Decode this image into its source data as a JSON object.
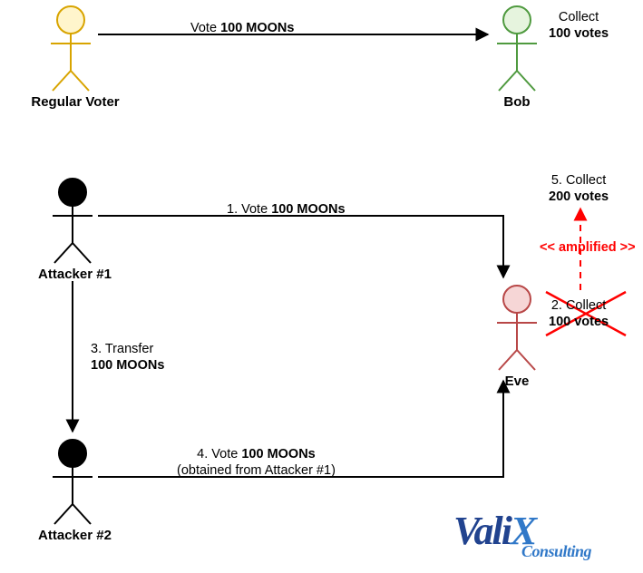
{
  "figures": {
    "regular_voter": {
      "label": "Regular Voter"
    },
    "bob": {
      "label": "Bob"
    },
    "attacker1": {
      "label": "Attacker #1"
    },
    "attacker2": {
      "label": "Attacker #2"
    },
    "eve": {
      "label": "Eve"
    }
  },
  "edges": {
    "vote_regular": {
      "pre": "Vote ",
      "bold": "100 MOONs",
      "post": ""
    },
    "collect_bob": {
      "pre": "Collect\n",
      "bold": "100 votes",
      "post": ""
    },
    "vote_a1": {
      "pre": "1. Vote ",
      "bold": "100 MOONs",
      "post": ""
    },
    "collect_eve_100": {
      "pre": "2. Collect\n",
      "bold": "100 votes",
      "post": ""
    },
    "transfer_a1_a2": {
      "pre": "3. Transfer\n",
      "bold": "100 MOONs",
      "post": ""
    },
    "vote_a2": {
      "pre": "4. Vote ",
      "bold": "100 MOONs",
      "post": "\n(obtained from Attacker #1)"
    },
    "collect_eve_200": {
      "pre": "5. Collect\n",
      "bold": "200 votes",
      "post": ""
    },
    "amplified": {
      "text": "<< amplified >>"
    }
  },
  "brand": {
    "name1": "Vali",
    "name2": "X",
    "sub": "Consulting"
  }
}
